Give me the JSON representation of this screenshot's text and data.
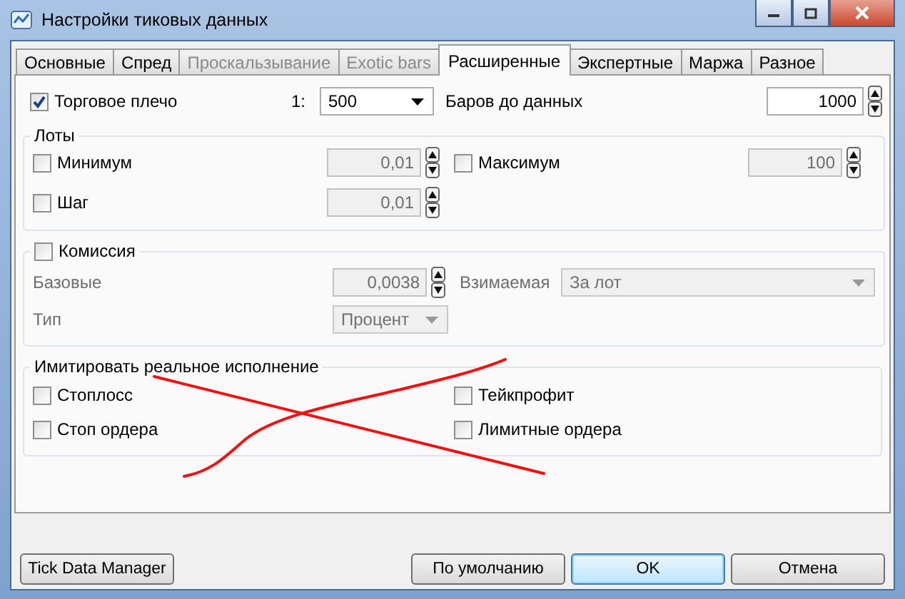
{
  "window": {
    "title": "Настройки тиковых данных"
  },
  "tabs": [
    {
      "label": "Основные",
      "selected": false,
      "disabled": false
    },
    {
      "label": "Спред",
      "selected": false,
      "disabled": false
    },
    {
      "label": "Проскальзывание",
      "selected": false,
      "disabled": true
    },
    {
      "label": "Exotic bars",
      "selected": false,
      "disabled": true
    },
    {
      "label": "Расширенные",
      "selected": true,
      "disabled": false
    },
    {
      "label": "Экспертные",
      "selected": false,
      "disabled": false
    },
    {
      "label": "Маржа",
      "selected": false,
      "disabled": false
    },
    {
      "label": "Разное",
      "selected": false,
      "disabled": false
    }
  ],
  "leverage": {
    "label": "Торговое плечо",
    "checked": true,
    "prefix": "1:",
    "value": "500"
  },
  "bars_before_data": {
    "label": "Баров до данных",
    "value": "1000"
  },
  "lots": {
    "title": "Лоты",
    "fields": [
      {
        "label": "Минимум",
        "checked": false,
        "value": "0,01"
      },
      {
        "label": "Максимум",
        "checked": false,
        "value": "100"
      },
      {
        "label": "Шаг",
        "checked": false,
        "value": "0,01"
      }
    ]
  },
  "commission": {
    "label": "Комиссия",
    "checked": false,
    "base": {
      "label": "Базовые",
      "value": "0,0038"
    },
    "charged": {
      "label": "Взимаемая",
      "value": "За лот"
    },
    "type": {
      "label": "Тип",
      "value": "Процент"
    }
  },
  "imitation": {
    "title": "Имитировать реальное исполнение",
    "options": [
      {
        "label": "Стоплосс",
        "checked": false
      },
      {
        "label": "Тейкпрофит",
        "checked": false
      },
      {
        "label": "Стоп ордера",
        "checked": false
      },
      {
        "label": "Лимитные ордера",
        "checked": false
      }
    ]
  },
  "buttons": [
    {
      "label": "Tick Data Manager",
      "default": false
    },
    {
      "label": "По умолчанию",
      "default": false
    },
    {
      "label": "OK",
      "default": true
    },
    {
      "label": "Отмена",
      "default": false
    }
  ]
}
